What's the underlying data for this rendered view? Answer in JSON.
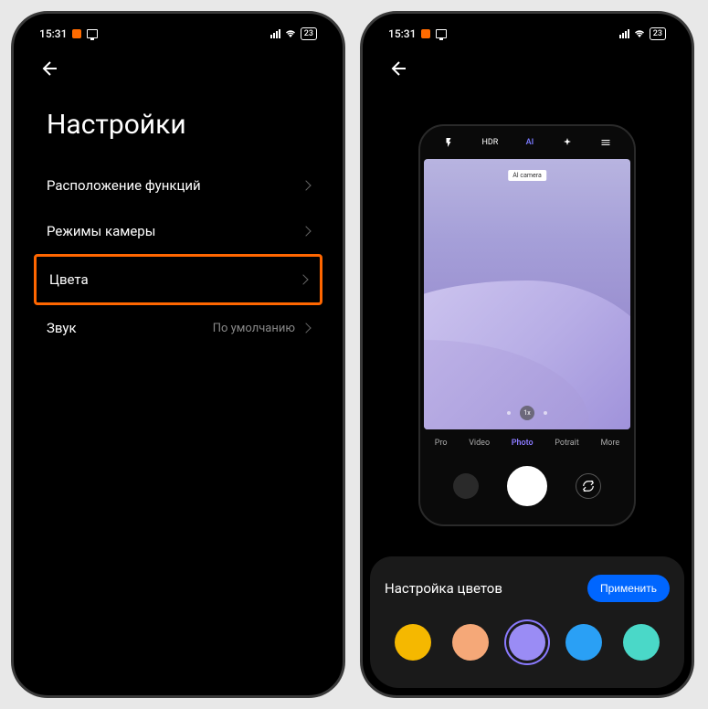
{
  "status": {
    "time": "15:31",
    "battery": "23"
  },
  "left_screen": {
    "title": "Настройки",
    "items": [
      {
        "label": "Расположение функций",
        "value": ""
      },
      {
        "label": "Режимы камеры",
        "value": ""
      },
      {
        "label": "Цвета",
        "value": ""
      },
      {
        "label": "Звук",
        "value": "По умолчанию"
      }
    ]
  },
  "right_screen": {
    "camera": {
      "top_bar": {
        "hdr": "HDR",
        "ai": "AI"
      },
      "ai_chip": "AI camera",
      "zoom": "1x",
      "modes": {
        "pro": "Pro",
        "video": "Video",
        "photo": "Photo",
        "portrait": "Potrait",
        "more": "More"
      }
    },
    "panel": {
      "title": "Настройка цветов",
      "apply": "Применить",
      "colors": [
        "#f5b800",
        "#f5a878",
        "#9a8cf5",
        "#2aa0f5",
        "#4ad8c8"
      ]
    }
  }
}
